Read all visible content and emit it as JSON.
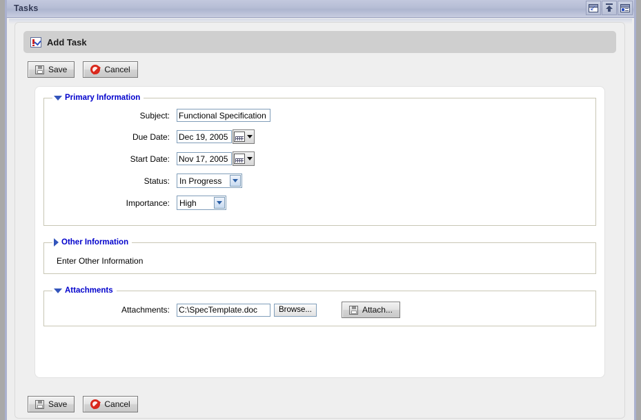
{
  "window": {
    "title": "Tasks",
    "buttons": [
      {
        "name": "restore-window",
        "icon": "restore-icon"
      },
      {
        "name": "move-up",
        "icon": "arrow-up-icon"
      },
      {
        "name": "details-view",
        "icon": "details-list-icon"
      }
    ]
  },
  "header": {
    "icon": "task-icon",
    "title": "Add Task"
  },
  "toolbar": {
    "save_label": "Save",
    "cancel_label": "Cancel",
    "save_icon": "floppy-disk-icon",
    "cancel_icon": "no-entry-icon"
  },
  "groups": {
    "primary": {
      "legend": "Primary Information",
      "expanded": true,
      "fields": {
        "subject": {
          "label": "Subject:",
          "value": "Functional Specification",
          "placeholder": ""
        },
        "due_date": {
          "label": "Due Date:",
          "value": "Dec 19, 2005",
          "picker_icon": "calendar-icon"
        },
        "start_date": {
          "label": "Start Date:",
          "value": "Nov 17, 2005",
          "picker_icon": "calendar-icon"
        },
        "status": {
          "label": "Status:",
          "value": "In Progress"
        },
        "importance": {
          "label": "Importance:",
          "value": "High"
        }
      }
    },
    "other": {
      "legend": "Other Information",
      "expanded": false,
      "body_text": "Enter Other Information"
    },
    "attachments": {
      "legend": "Attachments",
      "expanded": true,
      "field": {
        "label": "Attachments:",
        "value": "C:\\SpecTemplate.doc",
        "browse_label": "Browse...",
        "attach_label": "Attach...",
        "attach_icon": "floppy-disk-icon"
      }
    }
  },
  "footer": {
    "save_label": "Save",
    "cancel_label": "Cancel"
  }
}
